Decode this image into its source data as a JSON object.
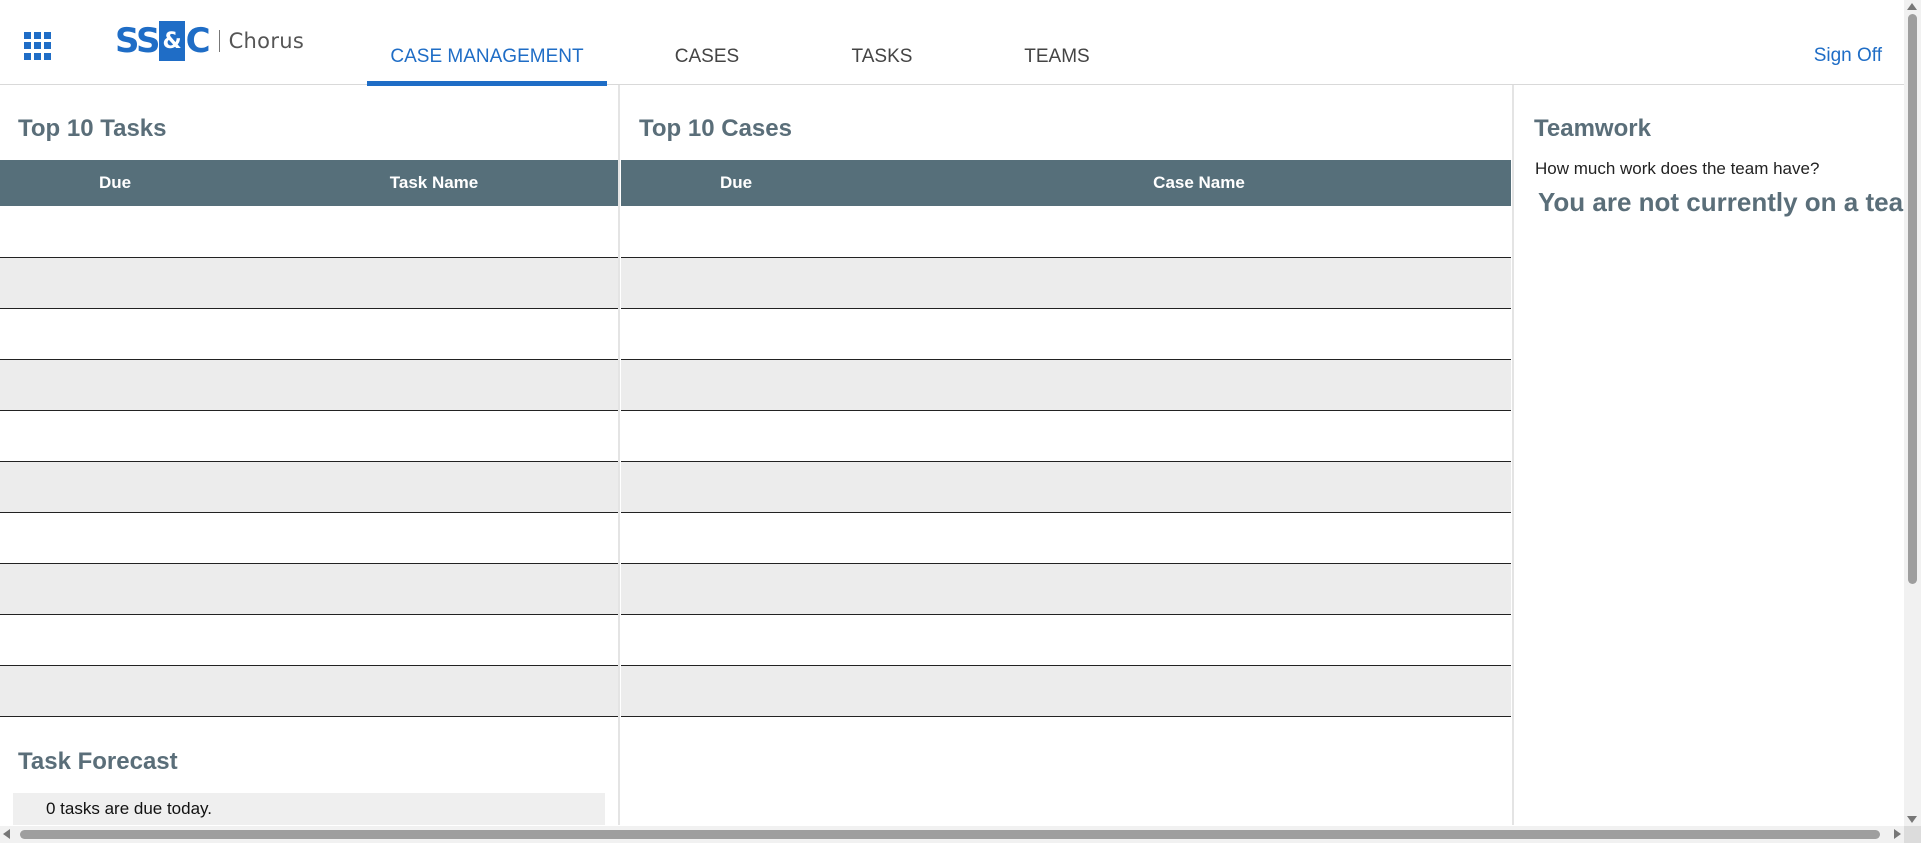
{
  "header": {
    "apps_icon": "grid-apps-icon",
    "logo": {
      "brand_left": "SS",
      "brand_amp": "&",
      "brand_right": "C",
      "product": "Chorus"
    },
    "tabs": [
      {
        "label": "CASE MANAGEMENT",
        "active": true
      },
      {
        "label": "CASES",
        "active": false
      },
      {
        "label": "TASKS",
        "active": false
      },
      {
        "label": "TEAMS",
        "active": false
      }
    ],
    "sign_off": "Sign Off"
  },
  "tasks": {
    "title": "Top 10 Tasks",
    "columns": [
      "Due",
      "Task Name"
    ],
    "rows": [
      {
        "due": "",
        "name": ""
      },
      {
        "due": "",
        "name": ""
      },
      {
        "due": "",
        "name": ""
      },
      {
        "due": "",
        "name": ""
      },
      {
        "due": "",
        "name": ""
      },
      {
        "due": "",
        "name": ""
      },
      {
        "due": "",
        "name": ""
      },
      {
        "due": "",
        "name": ""
      },
      {
        "due": "",
        "name": ""
      },
      {
        "due": "",
        "name": ""
      }
    ]
  },
  "cases": {
    "title": "Top 10 Cases",
    "columns": [
      "Due",
      "Case Name"
    ],
    "rows": [
      {
        "due": "",
        "name": ""
      },
      {
        "due": "",
        "name": ""
      },
      {
        "due": "",
        "name": ""
      },
      {
        "due": "",
        "name": ""
      },
      {
        "due": "",
        "name": ""
      },
      {
        "due": "",
        "name": ""
      },
      {
        "due": "",
        "name": ""
      },
      {
        "due": "",
        "name": ""
      },
      {
        "due": "",
        "name": ""
      },
      {
        "due": "",
        "name": ""
      }
    ]
  },
  "forecast": {
    "title": "Task Forecast",
    "message": "0 tasks are due today."
  },
  "teamwork": {
    "title": "Teamwork",
    "question": "How much work does the team have?",
    "status": "You are not currently on a team."
  },
  "colors": {
    "accent": "#1f6dc6",
    "grid_header": "#566f7a",
    "title_text": "#5a6e79",
    "alt_row": "#ececec"
  }
}
